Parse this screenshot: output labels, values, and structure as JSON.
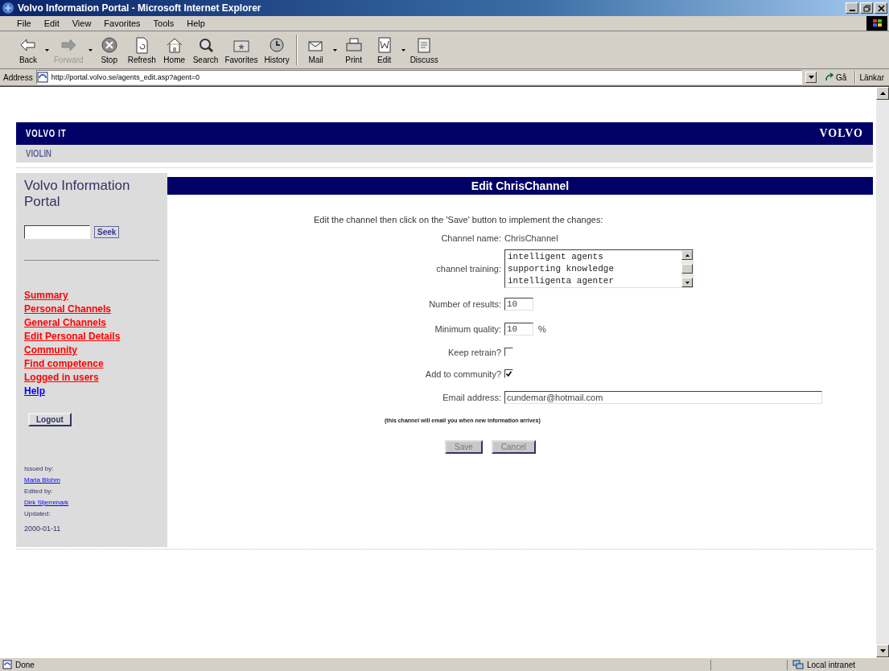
{
  "window": {
    "title": "Volvo Information Portal - Microsoft Internet Explorer"
  },
  "menu": [
    "File",
    "Edit",
    "View",
    "Favorites",
    "Tools",
    "Help"
  ],
  "toolbar": [
    {
      "label": "Back",
      "kind": "back",
      "disabled": false,
      "has_menu": true
    },
    {
      "label": "Forward",
      "kind": "forward",
      "disabled": true,
      "has_menu": true
    },
    {
      "label": "Stop",
      "kind": "stop",
      "disabled": false,
      "has_menu": false
    },
    {
      "label": "Refresh",
      "kind": "refresh",
      "disabled": false,
      "has_menu": false
    },
    {
      "label": "Home",
      "kind": "home",
      "disabled": false,
      "has_menu": false
    },
    {
      "label": "Search",
      "kind": "search",
      "disabled": false,
      "has_menu": false
    },
    {
      "label": "Favorites",
      "kind": "favorites",
      "disabled": false,
      "has_menu": false
    },
    {
      "label": "History",
      "kind": "history",
      "disabled": false,
      "has_menu": false
    },
    {
      "label": "Mail",
      "kind": "mail",
      "disabled": false,
      "has_menu": true
    },
    {
      "label": "Print",
      "kind": "print",
      "disabled": false,
      "has_menu": false
    },
    {
      "label": "Edit",
      "kind": "edit",
      "disabled": false,
      "has_menu": true
    },
    {
      "label": "Discuss",
      "kind": "discuss",
      "disabled": false,
      "has_menu": false
    }
  ],
  "address": {
    "label": "Address",
    "url": "http://portal.volvo.se/agents_edit.asp?agent=0",
    "go": "Gå",
    "links": "Länkar"
  },
  "header": {
    "brand": "VOLVO IT",
    "logo": "VOLVO",
    "subtitle": "VIOLIN"
  },
  "sidebar": {
    "title": "Volvo Information Portal",
    "search_button": "Seek",
    "nav": [
      {
        "label": "Summary",
        "color": "#ff0000"
      },
      {
        "label": "Personal Channels",
        "color": "#ff0000"
      },
      {
        "label": "General Channels",
        "color": "#ff0000"
      },
      {
        "label": "Edit Personal Details",
        "color": "#ff0000"
      },
      {
        "label": "Community",
        "color": "#ff0000"
      },
      {
        "label": "Find competence",
        "color": "#ff0000"
      },
      {
        "label": "Logged in users",
        "color": "#ff0000"
      },
      {
        "label": "Help",
        "color": "#0000ff"
      }
    ],
    "logout": "Logout",
    "meta": [
      {
        "kind": "label",
        "text": "Issued by:"
      },
      {
        "kind": "link",
        "text": "Maria Blohm"
      },
      {
        "kind": "label",
        "text": "Edited by:"
      },
      {
        "kind": "link",
        "text": "Dirk Stjernmark"
      },
      {
        "kind": "label",
        "text": "Updated:"
      },
      {
        "kind": "date",
        "text": "2000-01-11"
      }
    ]
  },
  "main": {
    "heading": "Edit ChrisChannel",
    "intro": "Edit the channel then click on the 'Save' button to implement the changes:",
    "fields": [
      {
        "kind": "static",
        "label": "Channel name:",
        "value": "ChrisChannel"
      },
      {
        "kind": "list",
        "label": "channel training:",
        "lines": [
          "intelligent agents",
          "supporting knowledge",
          "intelligenta agenter"
        ]
      },
      {
        "kind": "input",
        "label": "Number of results:",
        "value": "10"
      },
      {
        "kind": "input",
        "label": "Minimum quality:",
        "value": "10",
        "unit": "%"
      },
      {
        "kind": "checkbox",
        "label": "Keep retrain?",
        "checked": false
      },
      {
        "kind": "checkbox",
        "label": "Add to community?",
        "checked": true
      },
      {
        "kind": "email",
        "label": "Email address:",
        "value": "cundemar@hotmail.com"
      }
    ],
    "note": "(this channel will email you when new information arrives)",
    "buttons": [
      "Save",
      "Cancel"
    ]
  },
  "status_bar": {
    "text": "Done",
    "zone": "Local intranet"
  }
}
